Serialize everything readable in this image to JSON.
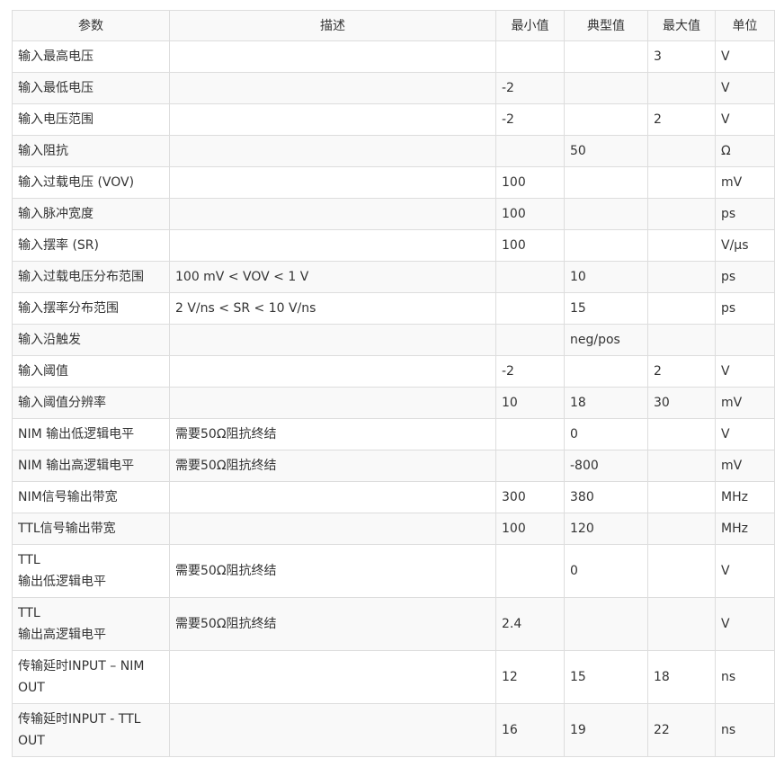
{
  "table": {
    "headers": [
      "参数",
      "描述",
      "最小值",
      "典型值",
      "最大值",
      "单位"
    ],
    "rows": [
      [
        "输入最高电压",
        "",
        "",
        "",
        "3",
        "V"
      ],
      [
        "输入最低电压",
        "",
        "-2",
        "",
        "",
        "V"
      ],
      [
        "输入电压范围",
        "",
        "-2",
        "",
        "2",
        "V"
      ],
      [
        "输入阻抗",
        "",
        "",
        "50",
        "",
        "Ω"
      ],
      [
        "输入过载电压 (VOV)",
        "",
        "100",
        "",
        "",
        "mV"
      ],
      [
        "输入脉冲宽度",
        "",
        "100",
        "",
        "",
        "ps"
      ],
      [
        "输入摆率 (SR)",
        "",
        "100",
        "",
        "",
        "V/µs"
      ],
      [
        "输入过载电压分布范围",
        "100 mV < VOV < 1 V",
        "",
        "10",
        "",
        "ps"
      ],
      [
        "输入摆率分布范围",
        "2 V/ns < SR < 10 V/ns",
        "",
        "15",
        "",
        "ps"
      ],
      [
        "输入沿触发",
        "",
        "",
        "neg/pos",
        "",
        ""
      ],
      [
        "输入阈值",
        "",
        "-2",
        "",
        "2",
        "V"
      ],
      [
        "输入阈值分辨率",
        "",
        "10",
        "18",
        "30",
        "mV"
      ],
      [
        "NIM 输出低逻辑电平",
        "需要50Ω阻抗终结",
        "",
        "0",
        "",
        "V"
      ],
      [
        "NIM 输出高逻辑电平",
        "需要50Ω阻抗终结",
        "",
        "-800",
        "",
        "mV"
      ],
      [
        "NIM信号输出带宽",
        "",
        "300",
        "380",
        "",
        "MHz"
      ],
      [
        "TTL信号输出带宽",
        "",
        "100",
        "120",
        "",
        "MHz"
      ],
      [
        "TTL\n输出低逻辑电平",
        "需要50Ω阻抗终结",
        "",
        "0",
        "",
        "V"
      ],
      [
        "TTL\n输出高逻辑电平",
        "需要50Ω阻抗终结",
        "2.4",
        "",
        "",
        "V"
      ],
      [
        "传输延时INPUT – NIM OUT",
        "",
        "12",
        "15",
        "18",
        "ns"
      ],
      [
        "传输延时INPUT - TTL OUT",
        "",
        "16",
        "19",
        "22",
        "ns"
      ]
    ]
  }
}
